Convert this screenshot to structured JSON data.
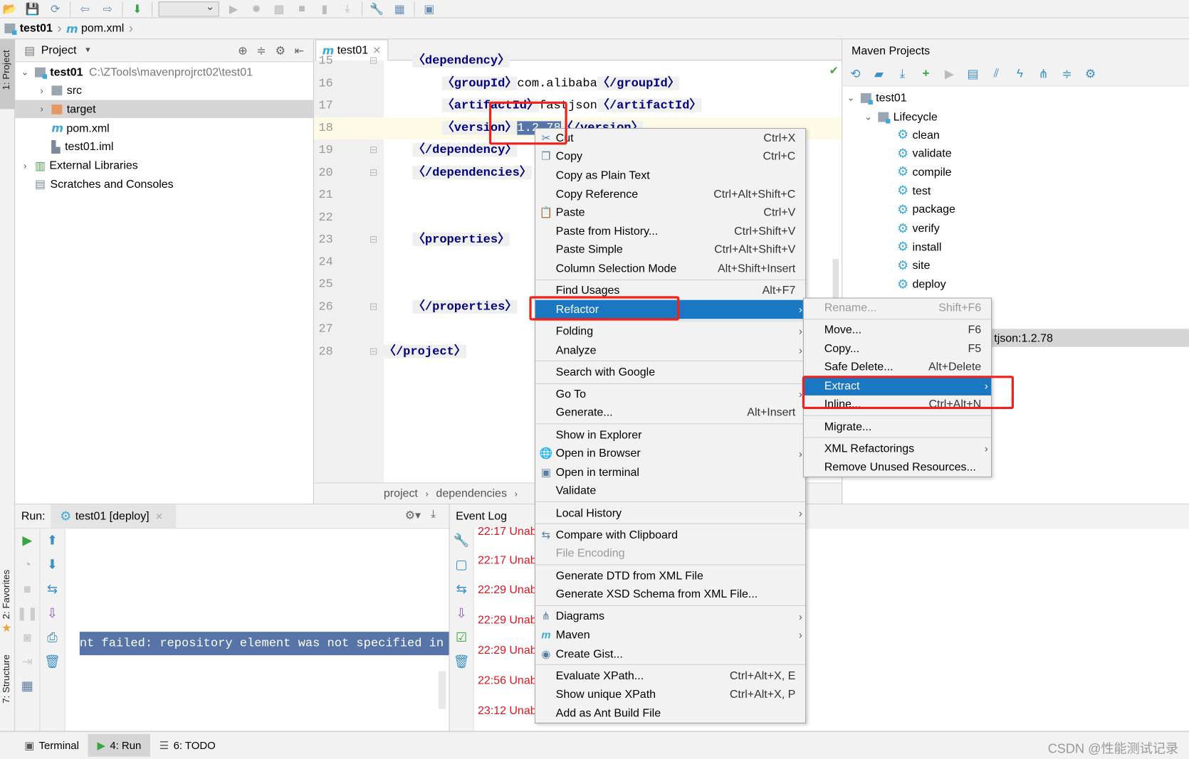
{
  "toolbar": {
    "icons": [
      "open-folder-icon",
      "save-icon",
      "sync-icon",
      "back-icon",
      "forward-icon",
      "build-icon",
      "run-config-dropdown",
      "run-icon",
      "debug-icon",
      "coverage-icon",
      "stop-icon",
      "attach-icon",
      "download-icon",
      "settings-wrench-icon",
      "project-structure-icon",
      "sdk-icon"
    ]
  },
  "nav": {
    "project": "test01",
    "file": "pom.xml"
  },
  "stripe": {
    "project": "1: Project",
    "favorites": "2: Favorites",
    "structure": "7: Structure"
  },
  "project_panel": {
    "title": "Project",
    "tree": [
      {
        "label": "test01",
        "path": "C:\\ZTools\\mavenprojrct02\\test01",
        "expanded": true,
        "bold": true,
        "level": 0,
        "icon": "module-folder-icon"
      },
      {
        "label": "src",
        "level": 1,
        "collapsed": true,
        "icon": "folder-icon"
      },
      {
        "label": "target",
        "level": 1,
        "collapsed": true,
        "icon": "excluded-folder-icon",
        "selected": true
      },
      {
        "label": "pom.xml",
        "level": 1,
        "icon": "maven-file-icon"
      },
      {
        "label": "test01.iml",
        "level": 1,
        "icon": "iml-file-icon"
      },
      {
        "label": "External Libraries",
        "level": 0,
        "collapsed": true,
        "icon": "libraries-icon"
      },
      {
        "label": "Scratches and Consoles",
        "level": 0,
        "icon": "scratches-icon"
      }
    ]
  },
  "editor": {
    "tab": "test01",
    "lines": [
      {
        "n": "15",
        "code": "    <dependency>"
      },
      {
        "n": "16",
        "code": "        <groupId>com.alibaba</groupId>"
      },
      {
        "n": "17",
        "code": "        <artifactId>fastjson</artifactId>"
      },
      {
        "n": "18",
        "code": "        <version>1.2.78</version>",
        "current": true,
        "selected": "1.2.78"
      },
      {
        "n": "19",
        "code": "    </dependency>"
      },
      {
        "n": "20",
        "code": "    </dependencies>"
      },
      {
        "n": "21",
        "code": ""
      },
      {
        "n": "22",
        "code": ""
      },
      {
        "n": "23",
        "code": "    <properties>"
      },
      {
        "n": "24",
        "code": ""
      },
      {
        "n": "25",
        "code": ""
      },
      {
        "n": "26",
        "code": "    </properties>"
      },
      {
        "n": "27",
        "code": ""
      },
      {
        "n": "28",
        "code": "</project>"
      }
    ],
    "breadcrumb": [
      "project",
      "dependencies"
    ]
  },
  "maven": {
    "title": "Maven Projects",
    "toolbar": [
      "reimport-icon",
      "generate-sources-icon",
      "download-icon",
      "add-icon",
      "run-icon",
      "execute-goal-icon",
      "toggle-offline-icon",
      "skip-tests-icon",
      "dependencies-icon",
      "collapse-icon",
      "settings-icon"
    ],
    "project": "test01",
    "lifecycle": "Lifecycle",
    "goals": [
      "clean",
      "validate",
      "compile",
      "test",
      "package",
      "verify",
      "install",
      "site",
      "deploy"
    ],
    "dependency_row": "tjson:1.2.78"
  },
  "run": {
    "label": "Run:",
    "tab": "test01 [deploy]",
    "console_line": "nt failed: repository element was not specified in t",
    "event_log": "Event Log",
    "event_times": [
      "22:17 Unab",
      "22:17 Unab",
      "22:29 Unab",
      "22:29 Unab",
      "22:29 Unab",
      "22:56 Unab",
      "23:12 Unab"
    ]
  },
  "status": {
    "tabs": [
      {
        "label": "Terminal",
        "icon": "terminal-icon"
      },
      {
        "label": "4: Run",
        "icon": "run-icon",
        "active": true
      },
      {
        "label": "6: TODO",
        "icon": "todo-icon"
      }
    ],
    "watermark": "CSDN @性能测试记录"
  },
  "context_menu": {
    "items": [
      {
        "label": "Cut",
        "shortcut": "Ctrl+X",
        "icon": "scissors-icon"
      },
      {
        "label": "Copy",
        "shortcut": "Ctrl+C",
        "icon": "copy-icon"
      },
      {
        "label": "Copy as Plain Text"
      },
      {
        "label": "Copy Reference",
        "shortcut": "Ctrl+Alt+Shift+C"
      },
      {
        "label": "Paste",
        "shortcut": "Ctrl+V",
        "icon": "paste-icon"
      },
      {
        "label": "Paste from History...",
        "shortcut": "Ctrl+Shift+V"
      },
      {
        "label": "Paste Simple",
        "shortcut": "Ctrl+Alt+Shift+V"
      },
      {
        "label": "Column Selection Mode",
        "shortcut": "Alt+Shift+Insert"
      },
      {
        "separator": true
      },
      {
        "label": "Find Usages",
        "shortcut": "Alt+F7"
      },
      {
        "label": "Refactor",
        "submenu": true,
        "highlighted": true
      },
      {
        "separator": true
      },
      {
        "label": "Folding",
        "submenu": true
      },
      {
        "label": "Analyze",
        "submenu": true
      },
      {
        "separator": true
      },
      {
        "label": "Search with Google"
      },
      {
        "separator": true
      },
      {
        "label": "Go To",
        "submenu": true
      },
      {
        "label": "Generate...",
        "shortcut": "Alt+Insert"
      },
      {
        "separator": true
      },
      {
        "label": "Show in Explorer"
      },
      {
        "label": "Open in Browser",
        "submenu": true,
        "icon": "globe-icon"
      },
      {
        "label": "Open in terminal",
        "icon": "terminal-icon"
      },
      {
        "label": "Validate"
      },
      {
        "separator": true
      },
      {
        "label": "Local History",
        "submenu": true
      },
      {
        "separator": true
      },
      {
        "label": "Compare with Clipboard",
        "icon": "compare-icon"
      },
      {
        "label": "File Encoding",
        "disabled": true
      },
      {
        "separator": true
      },
      {
        "label": "Generate DTD from XML File"
      },
      {
        "label": "Generate XSD Schema from XML File..."
      },
      {
        "separator": true
      },
      {
        "label": "Diagrams",
        "submenu": true,
        "icon": "diagram-icon"
      },
      {
        "label": "Maven",
        "submenu": true,
        "icon": "maven-icon"
      },
      {
        "label": "Create Gist...",
        "icon": "github-icon"
      },
      {
        "separator": true
      },
      {
        "label": "Evaluate XPath...",
        "shortcut": "Ctrl+Alt+X, E"
      },
      {
        "label": "Show unique XPath",
        "shortcut": "Ctrl+Alt+X, P"
      },
      {
        "label": "Add as Ant Build File"
      }
    ]
  },
  "refactor_menu": {
    "items": [
      {
        "label": "Rename...",
        "shortcut": "Shift+F6",
        "disabled": true
      },
      {
        "separator": true
      },
      {
        "label": "Move...",
        "shortcut": "F6"
      },
      {
        "label": "Copy...",
        "shortcut": "F5"
      },
      {
        "label": "Safe Delete...",
        "shortcut": "Alt+Delete"
      },
      {
        "label": "Extract",
        "submenu": true,
        "highlighted": true
      },
      {
        "label": "Inline...",
        "shortcut": "Ctrl+Alt+N"
      },
      {
        "separator": true
      },
      {
        "label": "Migrate..."
      },
      {
        "separator": true
      },
      {
        "label": "XML Refactorings",
        "submenu": true
      },
      {
        "label": "Remove Unused Resources..."
      }
    ]
  },
  "colors": {
    "highlight": "#1a78c2",
    "annotation": "#f0201a",
    "tag": "#000080",
    "error": "#e0141e",
    "selection": "#5674a8"
  }
}
